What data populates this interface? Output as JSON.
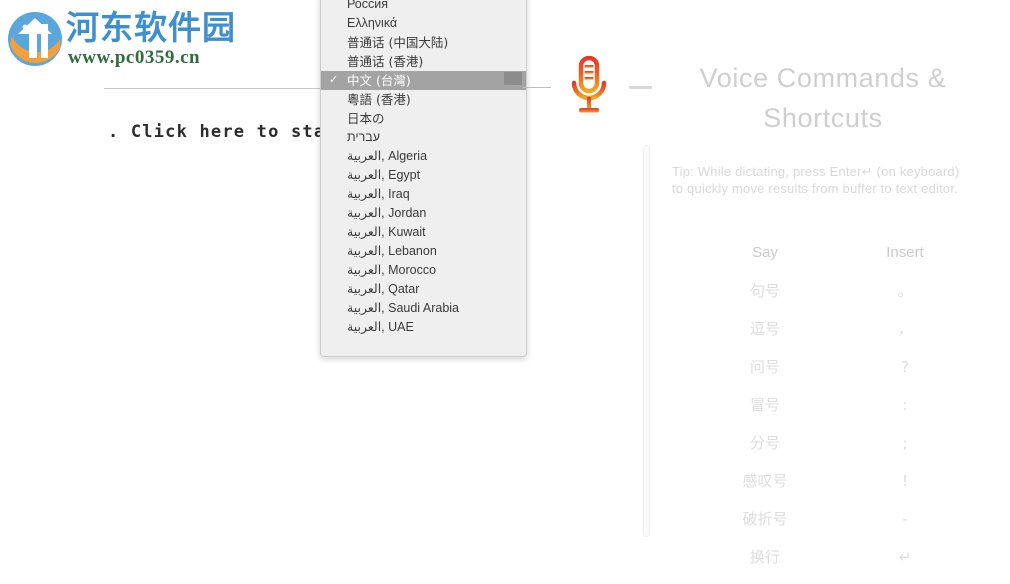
{
  "watermark": {
    "site_name": "河东软件园",
    "url": "www.pc0359.cn",
    "logo_icon": "site-logo-icon",
    "brand_blue": "#3d8fd0",
    "brand_green": "#2f6d3c",
    "brand_orange": "#f3a03a"
  },
  "document": {
    "visible_text": ". Click here to start"
  },
  "language_menu": {
    "scrollbar": "vertical-scrollbar-thumb",
    "check_glyph": "✓",
    "items": [
      {
        "label": "Россия",
        "selected": false,
        "cjk": false
      },
      {
        "label": "Ελληνικά",
        "selected": false,
        "cjk": false
      },
      {
        "label": "普通话 (中国大陆)",
        "selected": false,
        "cjk": true
      },
      {
        "label": "普通话 (香港)",
        "selected": false,
        "cjk": true
      },
      {
        "label": "中文 (台灣)",
        "selected": true,
        "cjk": true
      },
      {
        "label": "粵語 (香港)",
        "selected": false,
        "cjk": true
      },
      {
        "label": "日本の",
        "selected": false,
        "cjk": true
      },
      {
        "label": "עברית",
        "selected": false,
        "cjk": false
      },
      {
        "label": "العربية, Algeria",
        "selected": false,
        "cjk": false
      },
      {
        "label": "العربية, Egypt",
        "selected": false,
        "cjk": false
      },
      {
        "label": "العربية, Iraq",
        "selected": false,
        "cjk": false
      },
      {
        "label": "العربية, Jordan",
        "selected": false,
        "cjk": false
      },
      {
        "label": "العربية, Kuwait",
        "selected": false,
        "cjk": false
      },
      {
        "label": "العربية, Lebanon",
        "selected": false,
        "cjk": false
      },
      {
        "label": "العربية, Morocco",
        "selected": false,
        "cjk": false
      },
      {
        "label": "العربية, Qatar",
        "selected": false,
        "cjk": false
      },
      {
        "label": "العربية, Saudi Arabia",
        "selected": false,
        "cjk": false
      },
      {
        "label": "العربية, UAE",
        "selected": false,
        "cjk": false
      }
    ]
  },
  "microphone": {
    "icon": "microphone-icon",
    "color_top": "#e8372a",
    "color_bottom": "#f5a623"
  },
  "panel": {
    "title_line1": "Voice Commands &",
    "title_line2": "Shortcuts",
    "tip": "Tip: While dictating, press Enter↵ (on keyboard) to quickly move results from buffer to text editor.",
    "table": {
      "headers": [
        "Say",
        "Insert"
      ],
      "rows": [
        {
          "say": "句号",
          "insert": "。"
        },
        {
          "say": "逗号",
          "insert": "，"
        },
        {
          "say": "问号",
          "insert": "?"
        },
        {
          "say": "冒号",
          "insert": ":"
        },
        {
          "say": "分号",
          "insert": ";"
        },
        {
          "say": "感叹号",
          "insert": "!"
        },
        {
          "say": "破折号",
          "insert": "-"
        },
        {
          "say": "换行",
          "insert": "↵"
        }
      ]
    }
  }
}
